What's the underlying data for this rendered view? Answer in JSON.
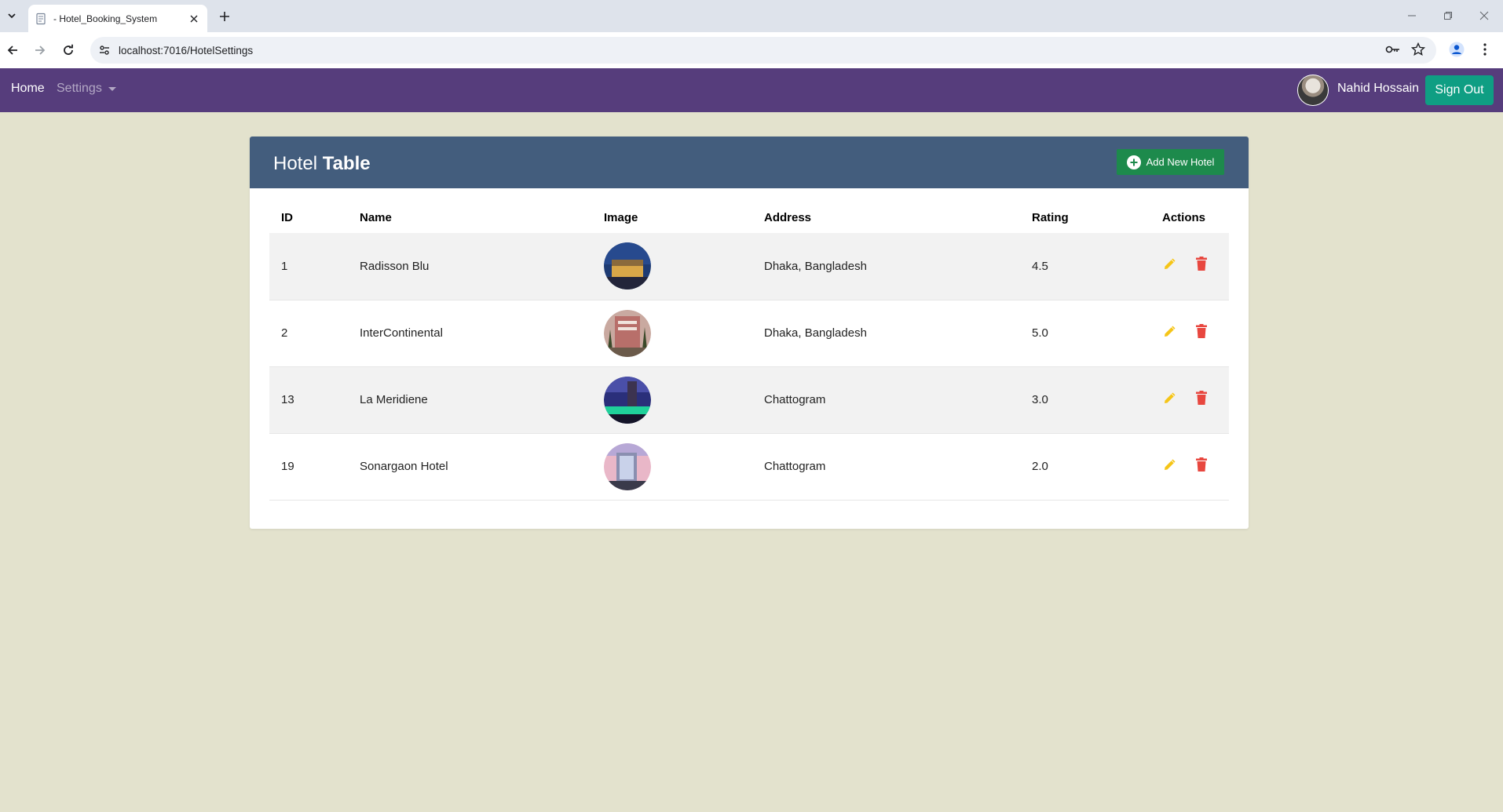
{
  "browser": {
    "tab_title": "- Hotel_Booking_System",
    "url": "localhost:7016/HotelSettings"
  },
  "nav": {
    "home": "Home",
    "settings": "Settings",
    "user_name": "Nahid Hossain",
    "sign_out": "Sign Out"
  },
  "card": {
    "title_part1": "Hotel",
    "title_part2": "Table",
    "add_button": "Add New Hotel"
  },
  "table": {
    "headers": [
      "ID",
      "Name",
      "Image",
      "Address",
      "Rating",
      "Actions"
    ],
    "rows": [
      {
        "id": "1",
        "name": "Radisson Blu",
        "address": "Dhaka, Bangladesh",
        "rating": "4.5"
      },
      {
        "id": "2",
        "name": "InterContinental",
        "address": "Dhaka, Bangladesh",
        "rating": "5.0"
      },
      {
        "id": "13",
        "name": "La Meridiene",
        "address": "Chattogram",
        "rating": "3.0"
      },
      {
        "id": "19",
        "name": "Sonargaon Hotel",
        "address": "Chattogram",
        "rating": "2.0"
      }
    ]
  },
  "colors": {
    "navbar": "#563d7c",
    "card_header": "#435d7d",
    "page_bg": "#e3e2cd",
    "signout": "#0f9e83",
    "add_button": "#1d8a4c",
    "edit_icon": "#f5c518",
    "delete_icon": "#e8473f"
  },
  "icons": {
    "edit": "pencil-icon",
    "delete": "trash-icon",
    "add": "plus-circle-icon"
  }
}
